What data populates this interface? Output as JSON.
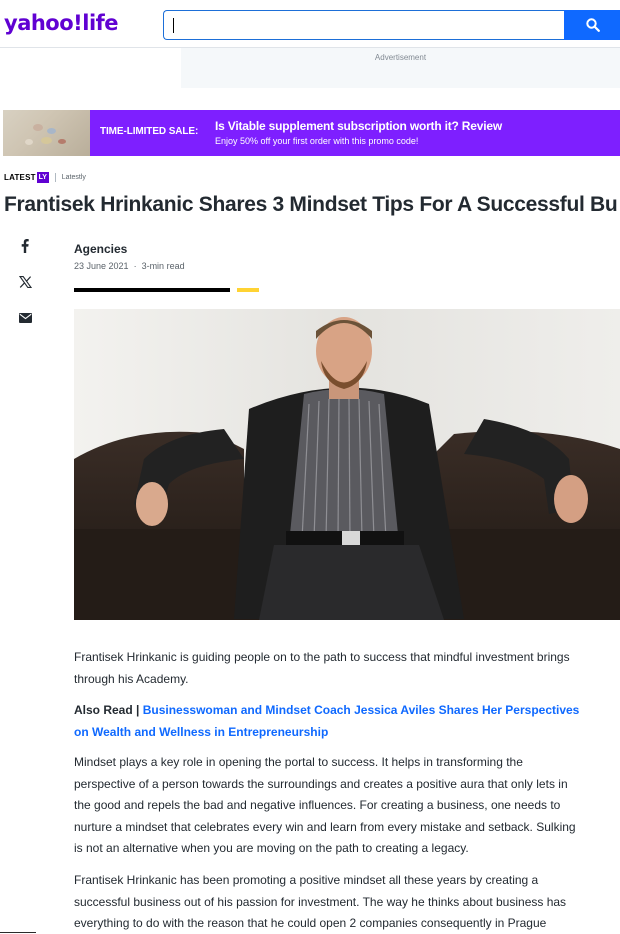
{
  "header": {
    "logo": "yahoo!life",
    "search_value": "",
    "search_button": "search-icon"
  },
  "ad": {
    "label": "Advertisement"
  },
  "promo": {
    "sale_label": "TIME-LIMITED SALE:",
    "title": "Is Vitable supplement subscription worth it? Review",
    "subtitle": "Enjoy 50% off your first order with this promo code!"
  },
  "provider": {
    "name": "LATEST",
    "badge": "LY",
    "sub": "Latestly"
  },
  "article": {
    "headline": "Frantisek Hrinkanic Shares 3 Mindset Tips For A Successful Bu",
    "author": "Agencies",
    "date": "23 June 2021",
    "read_time": "3-min read"
  },
  "share": {
    "facebook": "facebook-icon",
    "x": "x-icon",
    "email": "email-icon"
  },
  "body": {
    "p1": "Frantisek Hrinkanic is guiding people on to the path to success that mindful investment brings through his Academy.",
    "also_read_label": "Also Read |",
    "also_read_link": "Businesswoman and Mindset Coach Jessica Aviles Shares Her Perspectives on Wealth and Wellness in Entrepreneurship",
    "p2": "Mindset plays a key role in opening the portal to success. It helps in transforming the perspective of a person towards the surroundings and creates a positive aura that only lets in the good and repels the bad and negative influences. For creating a business, one needs to nurture a mindset that celebrates every win and learn from every mistake and setback. Sulking is not an alternative when you are moving on the path to creating a legacy.",
    "p3": "Frantisek Hrinkanic has been promoting a positive mindset all these years by creating a successful business out of his passion for investment. The way he thinks about business has everything to do with the reason that he could open 2 companies consequently in Prague"
  },
  "colors": {
    "brand": "#6001d2",
    "search_blue": "#0f69ff",
    "promo_purple": "#7e1fff",
    "accent_yellow": "#ffd333"
  }
}
